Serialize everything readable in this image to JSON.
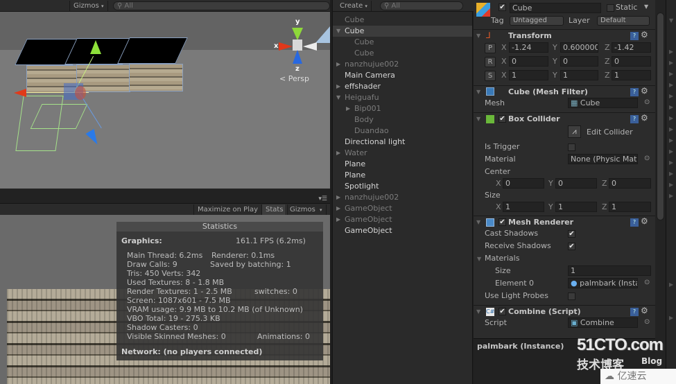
{
  "scene": {
    "gizmos_label": "Gizmos",
    "search_placeholder": "All",
    "axis_labels": {
      "x": "x",
      "y": "y",
      "z": "z"
    },
    "projection_label": "Persp"
  },
  "game": {
    "toolbar": {
      "maximize_on_play": "Maximize on Play",
      "stats": "Stats",
      "gizmos": "Gizmos"
    },
    "stats": {
      "title": "Statistics",
      "graphics_label": "Graphics:",
      "fps": "161.1 FPS (6.2ms)",
      "main_thread": "Main Thread: 6.2ms",
      "renderer": "Renderer: 0.1ms",
      "draw_calls": "Draw Calls: 9",
      "saved_by_batching": "Saved by batching: 1",
      "tris_verts": "Tris: 450  Verts: 342",
      "used_textures": "Used Textures: 8 - 1.8 MB",
      "render_textures": "Render Textures: 1 - 2.5 MB",
      "switches": "switches: 0",
      "screen": "Screen: 1087x601 - 7.5 MB",
      "vram_usage": "VRAM usage: 9.9 MB to 10.2 MB (of Unknown)",
      "vbo_total": "VBO Total: 19 - 275.3 KB",
      "shadow_casters": "Shadow Casters: 0",
      "visible_skinned_meshes": "Visible Skinned Meshes: 0",
      "animations": "Animations: 0",
      "network": "Network: (no players connected)"
    }
  },
  "hierarchy": {
    "create_label": "Create",
    "search_placeholder": "All",
    "items": [
      {
        "label": "Cube",
        "indent": 0,
        "arrow": "",
        "active": false,
        "selected": false
      },
      {
        "label": "Cube",
        "indent": 0,
        "arrow": "down",
        "active": true,
        "selected": true
      },
      {
        "label": "Cube",
        "indent": 1,
        "arrow": "",
        "active": false,
        "selected": false
      },
      {
        "label": "Cube",
        "indent": 1,
        "arrow": "",
        "active": false,
        "selected": false
      },
      {
        "label": "nanzhujue002",
        "indent": 0,
        "arrow": "right",
        "active": false,
        "selected": false
      },
      {
        "label": "Main Camera",
        "indent": 0,
        "arrow": "",
        "active": true,
        "selected": false
      },
      {
        "label": "effshader",
        "indent": 0,
        "arrow": "right",
        "active": true,
        "selected": false
      },
      {
        "label": "Heiguafu",
        "indent": 0,
        "arrow": "down",
        "active": false,
        "selected": false
      },
      {
        "label": "Bip001",
        "indent": 1,
        "arrow": "right",
        "active": false,
        "selected": false
      },
      {
        "label": "Body",
        "indent": 1,
        "arrow": "",
        "active": false,
        "selected": false
      },
      {
        "label": "Duandao",
        "indent": 1,
        "arrow": "",
        "active": false,
        "selected": false
      },
      {
        "label": "Directional light",
        "indent": 0,
        "arrow": "",
        "active": true,
        "selected": false
      },
      {
        "label": "Water",
        "indent": 0,
        "arrow": "right",
        "active": false,
        "selected": false
      },
      {
        "label": "Plane",
        "indent": 0,
        "arrow": "",
        "active": true,
        "selected": false
      },
      {
        "label": "Plane",
        "indent": 0,
        "arrow": "",
        "active": true,
        "selected": false
      },
      {
        "label": "Spotlight",
        "indent": 0,
        "arrow": "",
        "active": true,
        "selected": false
      },
      {
        "label": "nanzhujue002",
        "indent": 0,
        "arrow": "right",
        "active": false,
        "selected": false
      },
      {
        "label": "GameObject",
        "indent": 0,
        "arrow": "right",
        "active": false,
        "selected": false
      },
      {
        "label": "GameObject",
        "indent": 0,
        "arrow": "right",
        "active": false,
        "selected": false
      },
      {
        "label": "GameObject",
        "indent": 0,
        "arrow": "",
        "active": true,
        "selected": false
      }
    ]
  },
  "inspector": {
    "object_name": "Cube",
    "object_enabled": true,
    "static_label": "Static",
    "static_checked": false,
    "tag_label": "Tag",
    "tag_value": "Untagged",
    "layer_label": "Layer",
    "layer_value": "Default",
    "transform": {
      "title": "Transform",
      "position": {
        "btn": "P",
        "x": "-1.24",
        "y": "0.600000",
        "z": "-1.42"
      },
      "rotation": {
        "btn": "R",
        "x": "0",
        "y": "0",
        "z": "0"
      },
      "scale": {
        "btn": "S",
        "x": "1",
        "y": "1",
        "z": "1"
      }
    },
    "axis": {
      "x": "X",
      "y": "Y",
      "z": "Z"
    },
    "mesh_filter": {
      "title": "Cube (Mesh Filter)",
      "mesh_label": "Mesh",
      "mesh_value": "Cube"
    },
    "box_collider": {
      "title": "Box Collider",
      "enabled": true,
      "edit_collider": "Edit Collider",
      "is_trigger_label": "Is Trigger",
      "is_trigger": false,
      "material_label": "Material",
      "material_value": "None (Physic Material)",
      "center_label": "Center",
      "center": {
        "x": "0",
        "y": "0",
        "z": "0"
      },
      "size_label": "Size",
      "size": {
        "x": "1",
        "y": "1",
        "z": "1"
      }
    },
    "mesh_renderer": {
      "title": "Mesh Renderer",
      "enabled": true,
      "cast_shadows_label": "Cast Shadows",
      "cast_shadows": true,
      "receive_shadows_label": "Receive Shadows",
      "receive_shadows": true,
      "materials_label": "Materials",
      "size_label": "Size",
      "size_value": "1",
      "element0_label": "Element 0",
      "element0_value": "palmbark (Instance)",
      "light_probes_label": "Use Light Probes",
      "light_probes": false
    },
    "combine_script": {
      "title": "Combine (Script)",
      "enabled": true,
      "script_label": "Script",
      "script_value": "Combine"
    },
    "preview_title": "palmbark (Instance)"
  },
  "watermark": {
    "site": "51CTO.com",
    "subtitle_cn": "技术博客",
    "blog": "Blog",
    "yisu": "亿速云"
  },
  "icons": {
    "check": "✔",
    "gear": "⚙",
    "help": "?",
    "target": "⊙",
    "arrow_down": "▼",
    "arrow_right": "▶"
  }
}
